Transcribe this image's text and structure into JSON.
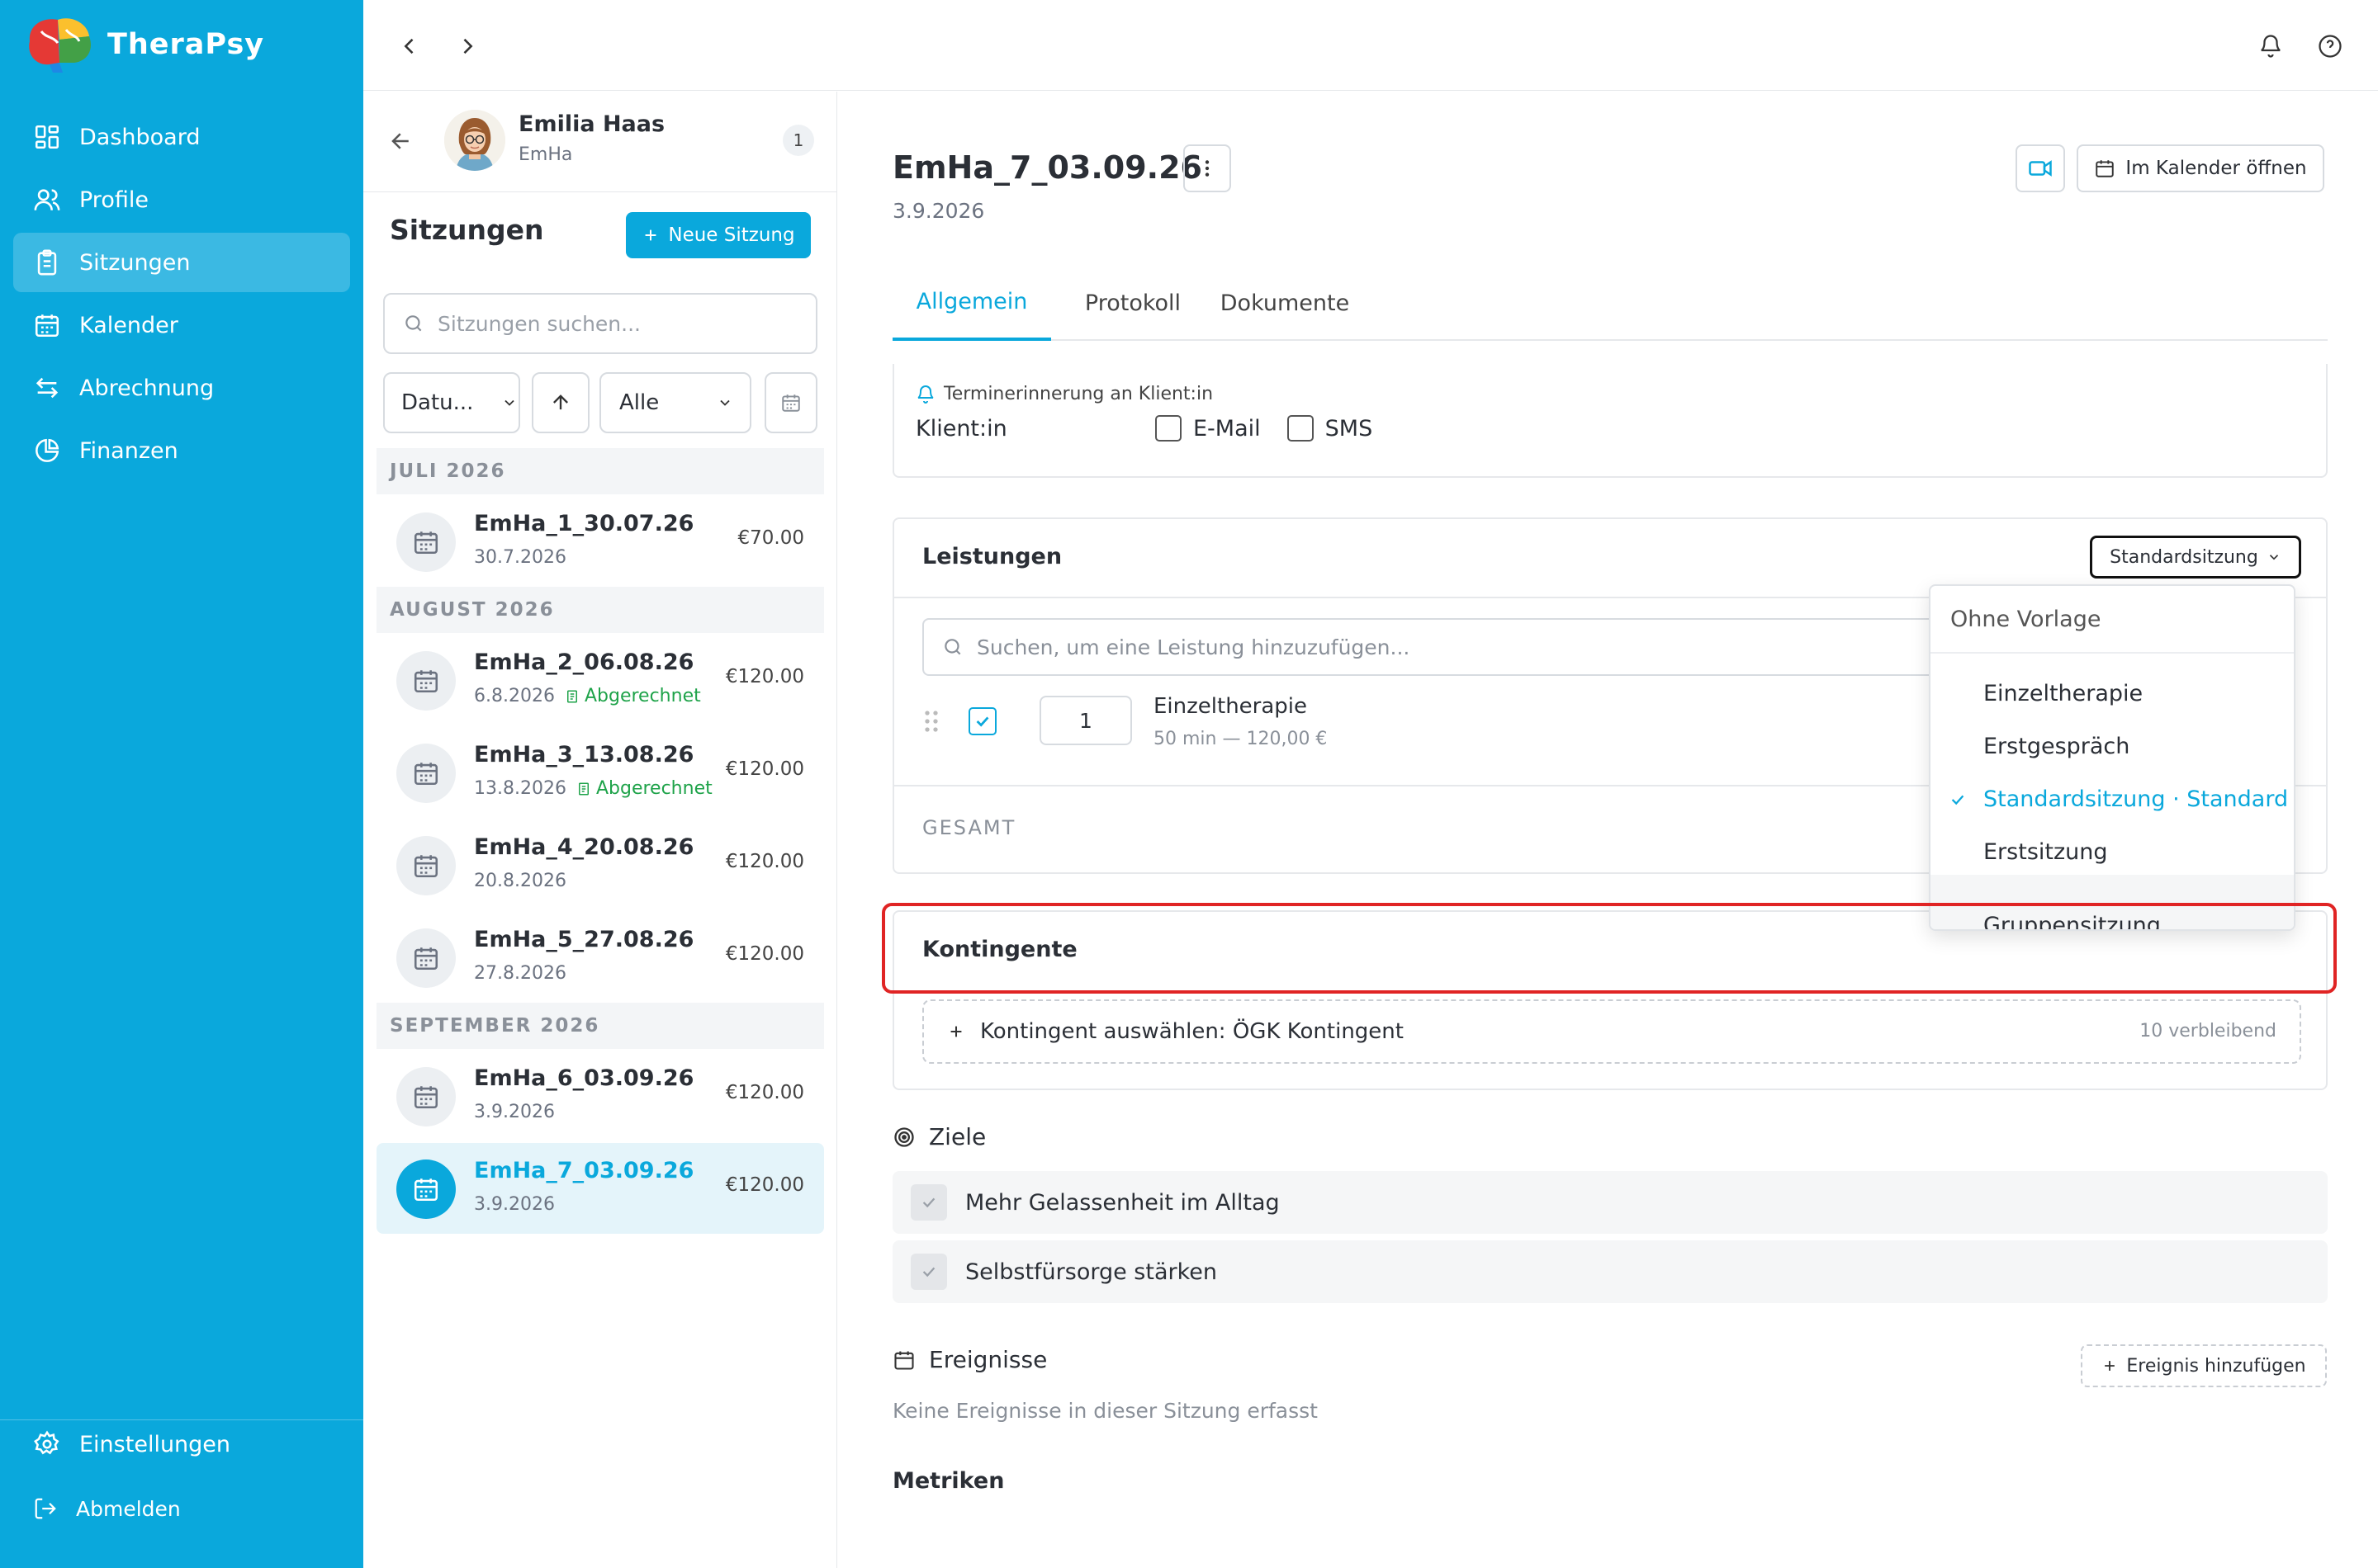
{
  "app": {
    "name": "TheraPsy"
  },
  "sidebar": {
    "items": [
      {
        "label": "Dashboard",
        "icon": "dashboard-icon"
      },
      {
        "label": "Profile",
        "icon": "users-icon"
      },
      {
        "label": "Sitzungen",
        "icon": "clipboard-icon"
      },
      {
        "label": "Kalender",
        "icon": "calendar-icon"
      },
      {
        "label": "Abrechnung",
        "icon": "arrows-icon"
      },
      {
        "label": "Finanzen",
        "icon": "pie-chart-icon"
      }
    ],
    "settings_label": "Einstellungen",
    "logout_label": "Abmelden"
  },
  "client": {
    "name": "Emilia Haas",
    "short": "EmHa",
    "count": "1"
  },
  "sessions": {
    "title": "Sitzungen",
    "new_button": "Neue Sitzung",
    "search_placeholder": "Sitzungen suchen...",
    "sort_label": "Datu...",
    "filter_label": "Alle",
    "groups": [
      {
        "label": "JULI 2026"
      },
      {
        "label": "AUGUST 2026"
      },
      {
        "label": "SEPTEMBER 2026"
      }
    ],
    "items": [
      {
        "title": "EmHa_1_30.07.26",
        "date": "30.7.2026",
        "price": "€70.00",
        "badge": ""
      },
      {
        "title": "EmHa_2_06.08.26",
        "date": "6.8.2026",
        "price": "€120.00",
        "badge": "Abgerechnet"
      },
      {
        "title": "EmHa_3_13.08.26",
        "date": "13.8.2026",
        "price": "€120.00",
        "badge": "Abgerechnet"
      },
      {
        "title": "EmHa_4_20.08.26",
        "date": "20.8.2026",
        "price": "€120.00",
        "badge": ""
      },
      {
        "title": "EmHa_5_27.08.26",
        "date": "27.8.2026",
        "price": "€120.00",
        "badge": ""
      },
      {
        "title": "EmHa_6_03.09.26",
        "date": "3.9.2026",
        "price": "€120.00",
        "badge": ""
      },
      {
        "title": "EmHa_7_03.09.26",
        "date": "3.9.2026",
        "price": "€120.00",
        "badge": ""
      }
    ]
  },
  "main": {
    "title": "EmHa_7_03.09.26",
    "date": "3.9.2026",
    "calendar_button": "Im Kalender öffnen",
    "tabs": [
      "Allgemein",
      "Protokoll",
      "Dokumente"
    ],
    "reminder": {
      "label": "Terminerinnerung an Klient:in",
      "row_label": "Klient:in",
      "email": "E-Mail",
      "sms": "SMS"
    },
    "services": {
      "title": "Leistungen",
      "template_value": "Standardsitzung",
      "search_placeholder": "Suchen, um eine Leistung hinzuzufügen...",
      "item": {
        "qty": "1",
        "name": "Einzeltherapie",
        "sub": "50 min — 120,00 €"
      },
      "total_label": "GESAMT"
    },
    "template_dropdown": {
      "options": [
        "Ohne Vorlage",
        "Einzeltherapie",
        "Erstgespräch",
        "Standardsitzung · Standard",
        "Erstsitzung",
        "Gruppensitzung"
      ]
    },
    "quotas": {
      "title": "Kontingente",
      "add_label": "Kontingent auswählen: ÖGK Kontingent",
      "remaining": "10 verbleibend"
    },
    "goals": {
      "title": "Ziele",
      "items": [
        "Mehr Gelassenheit im Alltag",
        "Selbstfürsorge stärken"
      ]
    },
    "events": {
      "title": "Ereignisse",
      "add_button": "Ereignis hinzufügen",
      "empty": "Keine Ereignisse in dieser Sitzung erfasst"
    },
    "metrics": {
      "title": "Metriken"
    }
  },
  "colors": {
    "brand": "#0aa8dc",
    "success": "#1fa34a",
    "highlight": "#e02424"
  }
}
